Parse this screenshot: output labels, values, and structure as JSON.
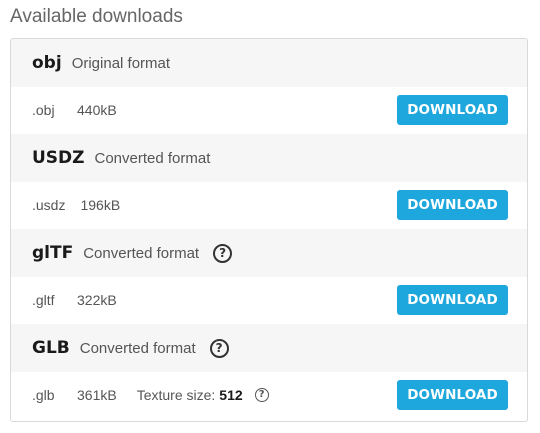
{
  "heading": "Available downloads",
  "downloads": [
    {
      "name": "obj",
      "description": "Original format",
      "extension": ".obj",
      "size": "440kB",
      "button": "DOWNLOAD",
      "has_help": false
    },
    {
      "name": "USDZ",
      "description": "Converted format",
      "extension": ".usdz",
      "size": "196kB",
      "button": "DOWNLOAD",
      "has_help": false
    },
    {
      "name": "glTF",
      "description": "Converted format",
      "extension": ".gltf",
      "size": "322kB",
      "button": "DOWNLOAD",
      "has_help": true
    },
    {
      "name": "GLB",
      "description": "Converted format",
      "extension": ".glb",
      "size": "361kB",
      "button": "DOWNLOAD",
      "has_help": true,
      "texture_label": "Texture size:",
      "texture_value": "512"
    }
  ],
  "help_icon_glyph": "?",
  "colors": {
    "accent": "#1ea7dc",
    "header_bg": "#f6f6f7",
    "border": "#d9d9d9"
  }
}
